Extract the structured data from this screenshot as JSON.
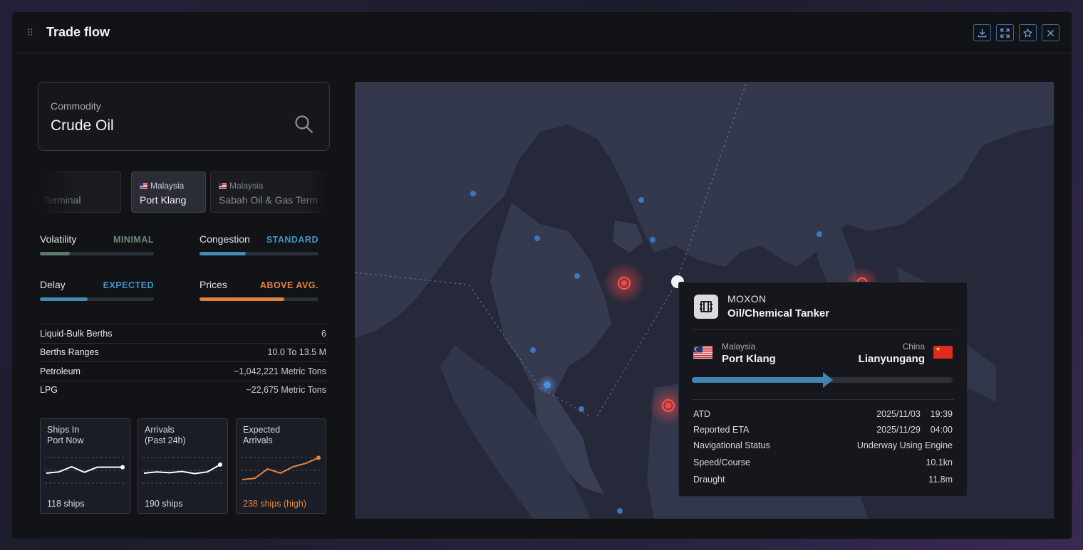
{
  "window": {
    "title": "Trade flow",
    "actions": [
      {
        "name": "download-icon"
      },
      {
        "name": "expand-icon"
      },
      {
        "name": "star-icon"
      },
      {
        "name": "close-icon"
      }
    ]
  },
  "commodity": {
    "label": "Commodity",
    "value": "Crude Oil"
  },
  "ports": [
    {
      "country": "",
      "name": "je Oil Terminal",
      "state": "dim"
    },
    {
      "country": "Malaysia",
      "name": "Port Klang",
      "state": "active"
    },
    {
      "country": "Malaysia",
      "name": "Sabah Oil & Gas Term",
      "state": "dim"
    }
  ],
  "metrics": {
    "volatility": {
      "label": "Volatility",
      "level": "MINIMAL",
      "fill": 0.26,
      "color": "#5d7b6a",
      "level_color": "#6c8b7b"
    },
    "congestion": {
      "label": "Congestion",
      "level": "STANDARD",
      "fill": 0.39,
      "color": "#3f8db4",
      "level_color": "#3f95c4"
    },
    "delay": {
      "label": "Delay",
      "level": "EXPECTED",
      "fill": 0.42,
      "color": "#3f8db4",
      "level_color": "#3f95c4"
    },
    "prices": {
      "label": "Prices",
      "level": "ABOVE AVG.",
      "fill": 0.71,
      "color": "#e0823f",
      "level_color": "#e8843f"
    }
  },
  "stats": [
    {
      "label": "Liquid-Bulk Berths",
      "value": "6"
    },
    {
      "label": "Berths Ranges",
      "value": "10.0 To 13.5 M"
    },
    {
      "label": "Petroleum",
      "value": "~1,042,221 Metric Tons"
    },
    {
      "label": "LPG",
      "value": "~22,675 Metric Tons"
    }
  ],
  "sparks": [
    {
      "title": "Ships In\nPort Now",
      "footer": "118 ships",
      "color": "#ffffff",
      "footer_color": "#d7dae0",
      "values": [
        3,
        3.3,
        4.5,
        3.2,
        4.4,
        4.4,
        4.4
      ]
    },
    {
      "title": "Arrivals\n(Past 24h)",
      "footer": "190 ships",
      "color": "#ffffff",
      "footer_color": "#d7dae0",
      "values": [
        3,
        3.3,
        3.1,
        3.4,
        2.9,
        3.3,
        5
      ]
    },
    {
      "title": "Expected\nArrivals",
      "footer": "238 ships (high)",
      "color": "#e8843f",
      "footer_color": "#e8843f",
      "values": [
        1.5,
        1.8,
        4,
        3,
        4.5,
        5.3,
        6.6
      ]
    }
  ],
  "vessel": {
    "name": "MOXON",
    "type": "Oil/Chemical Tanker",
    "from": {
      "country": "Malaysia",
      "port": "Port Klang"
    },
    "to": {
      "country": "China",
      "port": "Lianyungang"
    },
    "progress": 0.53,
    "details": [
      {
        "label": "ATD",
        "value": "2025/11/03    19:39"
      },
      {
        "label": "Reported ETA",
        "value": "2025/11/29    04:00"
      },
      {
        "label": "Navigational Status",
        "value": "Underway Using Engine"
      },
      {
        "label": "Speed/Course",
        "value": "10.1kn"
      },
      {
        "label": "Draught",
        "value": "11.8m"
      }
    ]
  }
}
